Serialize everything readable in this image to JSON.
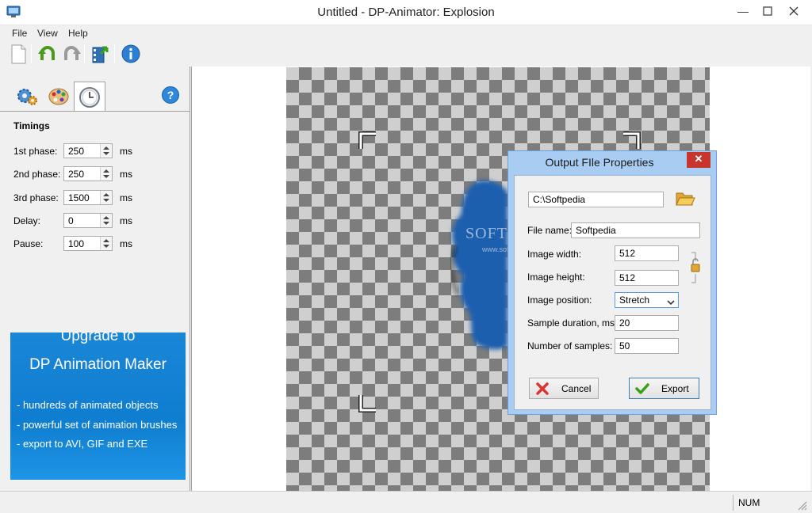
{
  "window": {
    "title": "Untitled - DP-Animator: Explosion",
    "controls": [
      "minimize",
      "maximize",
      "close"
    ]
  },
  "menu": {
    "items": [
      "File",
      "View",
      "Help"
    ]
  },
  "toolbar": {
    "buttons": [
      "new-document-icon",
      "undo-icon",
      "redo-icon",
      "export-film-icon",
      "info-icon"
    ]
  },
  "left_panel": {
    "tabs": [
      "settings-gears-icon",
      "palette-icon",
      "clock-icon"
    ],
    "active_tab": "clock-icon",
    "help": "help-icon",
    "timings": {
      "heading": "Timings",
      "unit": "ms",
      "rows": [
        {
          "label": "1st phase:",
          "value": "250"
        },
        {
          "label": "2nd phase:",
          "value": "250"
        },
        {
          "label": "3rd phase:",
          "value": "1500"
        },
        {
          "label": "Delay:",
          "value": "0"
        },
        {
          "label": "Pause:",
          "value": "100"
        }
      ]
    },
    "promo": {
      "line1": "Upgrade to",
      "line2": "DP Animation Maker",
      "features": [
        "- hundreds of animated objects",
        "- powerful set of animation brushes",
        "- export to AVI, GIF and EXE"
      ]
    }
  },
  "dialog": {
    "title": "Output FIle Properties",
    "folder_path": "C:\\Softpedia",
    "file_name": {
      "label": "File name:",
      "value": "Softpedia"
    },
    "image_width": {
      "label": "Image width:",
      "value": "512"
    },
    "image_height": {
      "label": "Image height:",
      "value": "512"
    },
    "image_position": {
      "label": "Image position:",
      "value": "Stretch"
    },
    "sample_duration": {
      "label": "Sample duration, ms:",
      "value": "20"
    },
    "number_of_samples": {
      "label": "Number of samples:",
      "value": "50"
    },
    "cancel_label": "Cancel",
    "export_label": "Export"
  },
  "watermark": {
    "brand": "SOFTPEDIA",
    "url": "www.softpedia.com"
  },
  "status_bar": {
    "num": "NUM"
  },
  "colors": {
    "promo_blue": "#1385d8",
    "dialog_frame": "#a9cdf2",
    "close_red": "#c7352c",
    "effect_blue": "#1c5fae"
  }
}
